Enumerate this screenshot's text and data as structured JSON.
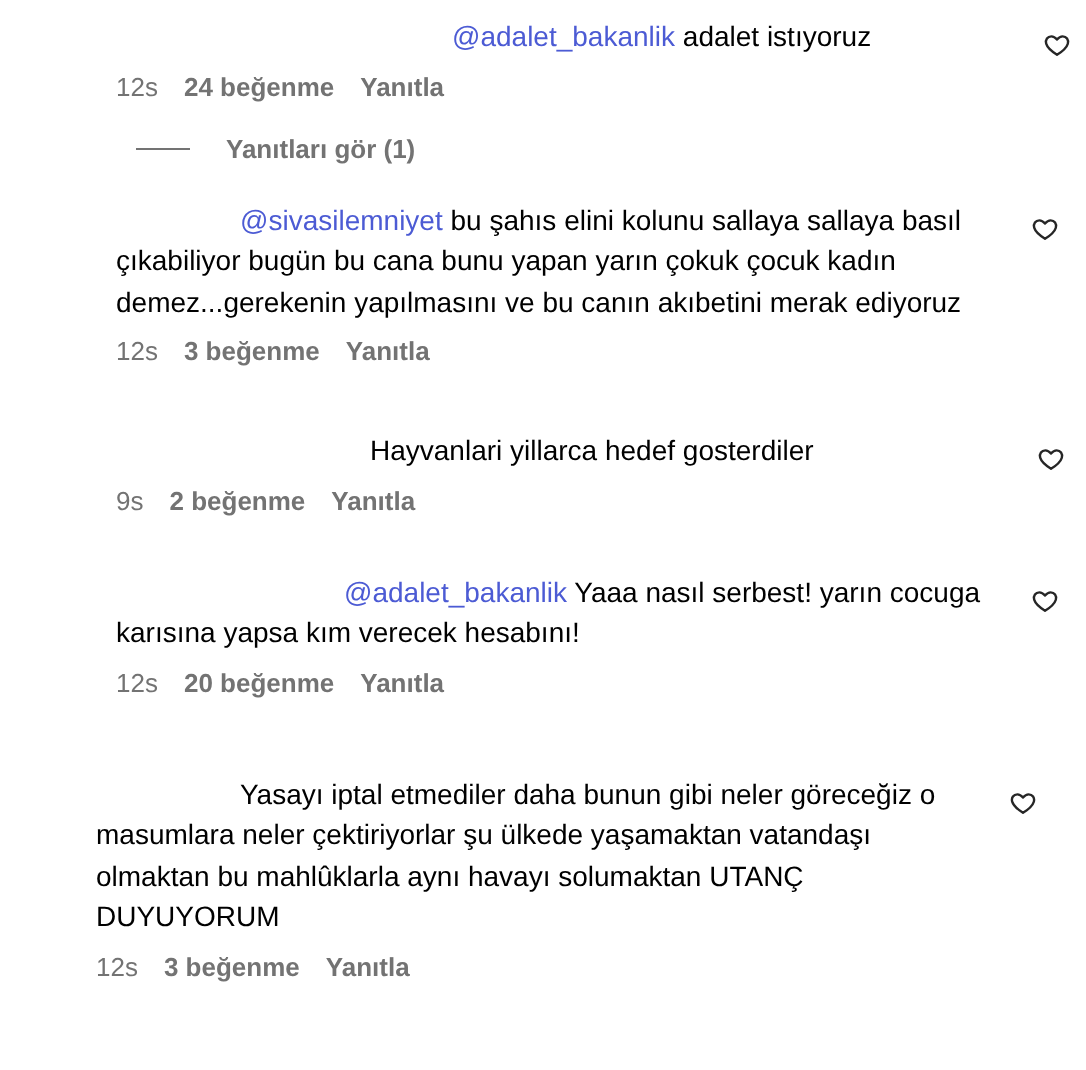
{
  "comments": [
    {
      "mention": "@adalet_bakanlik",
      "text": "adalet istıyoruz",
      "time": "12s",
      "likes": "24 beğenme",
      "reply": "Yanıtla",
      "view_replies": "Yanıtları gör (1)"
    },
    {
      "mention": "@sivasilemniyet",
      "text": "bu şahıs elini kolunu sallaya sallaya basıl çıkabiliyor bugün bu cana bunu yapan yarın çokuk çocuk kadın demez...gerekenin yapılmasını ve bu canın akıbetini merak ediyoruz",
      "time": "12s",
      "likes": "3 beğenme",
      "reply": "Yanıtla"
    },
    {
      "text": "Hayvanlari yillarca hedef gosterdiler",
      "time": "9s",
      "likes": "2 beğenme",
      "reply": "Yanıtla"
    },
    {
      "mention": "@adalet_bakanlik",
      "text": "Yaaa nasıl serbest! yarın cocuga karısına yapsa kım verecek hesabını!",
      "time": "12s",
      "likes": "20 beğenme",
      "reply": "Yanıtla"
    },
    {
      "text": "Yasayı iptal etmediler daha bunun gibi neler göreceğiz o masumlara neler çektiriyorlar şu ülkede yaşamaktan vatandaşı olmaktan bu mahlûklarla aynı havayı solumaktan UTANÇ DUYUYORUM",
      "time": "12s",
      "likes": "3 beğenme",
      "reply": "Yanıtla"
    }
  ]
}
